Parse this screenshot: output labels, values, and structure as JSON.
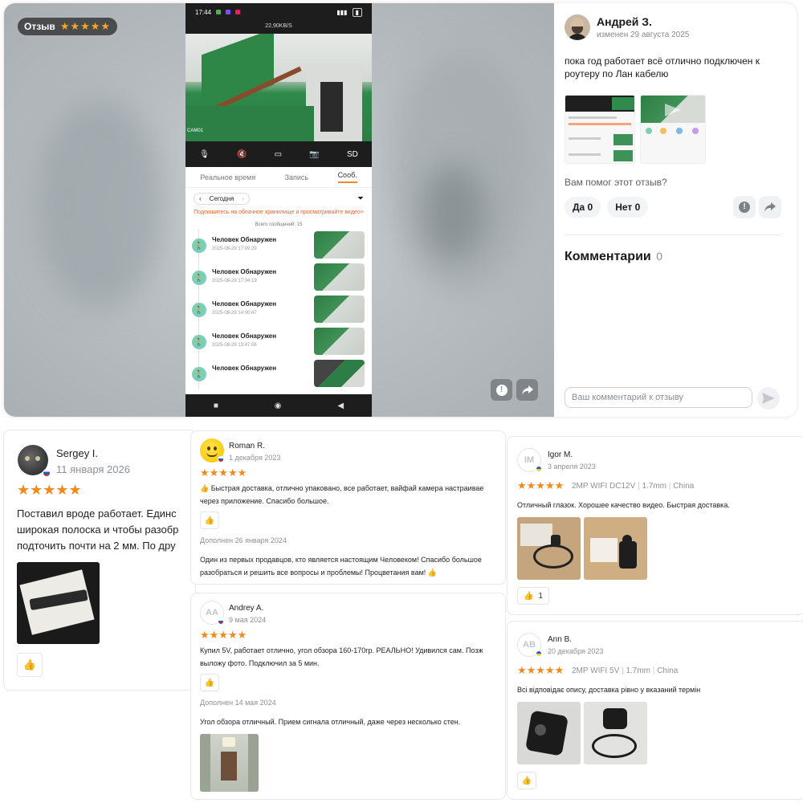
{
  "modal": {
    "badge_label": "Отзыв",
    "badge_stars": "★★★★★",
    "phone": {
      "time": "17:44",
      "speed": "22,90KB/S",
      "cam_label": "CAM01",
      "tools": [
        "mic",
        "mute",
        "record",
        "camera",
        "SD"
      ],
      "tools_sd": "SD",
      "tabs": [
        "Реальное время",
        "Запись",
        "Сооб."
      ],
      "date_label": "Сегодня",
      "cloud_notice": "Подпишитесь на облачное хранилище и просматривайте видео>",
      "total": "Всего сообщений: 15",
      "events": [
        {
          "title": "Человек Обнаружен",
          "date": "2025-08-29 17:09:29"
        },
        {
          "title": "Человек Обнаружен",
          "date": "2025-08-29 17:04:19"
        },
        {
          "title": "Человек Обнаружен",
          "date": "2025-08-29 14:00:47"
        },
        {
          "title": "Человек Обнаружен",
          "date": "2025-08-29 13:47:06"
        },
        {
          "title": "Человек Обнаружен",
          "date": ""
        }
      ]
    },
    "review": {
      "author": "Андрей З.",
      "edited": "изменен 29 августа 2025",
      "text_line1": "пока год работает всё отлично подключен к",
      "text_line2": "роутеру по Лан кабелю",
      "helpful_question": "Вам помог этот отзыв?",
      "yes_label": "Да 0",
      "no_label": "Нет 0",
      "comments_title": "Комментарии",
      "comments_count": "0",
      "comment_placeholder": "Ваш комментарий к отзыву"
    }
  },
  "cards": {
    "sergey": {
      "name": "Sergey I.",
      "date": "11 января 2026",
      "stars": "★★★★★",
      "text": [
        "Поставил вроде работает. Единс",
        "широкая полоска и чтобы разобр",
        "подточить почти на 2 мм. По дру"
      ]
    },
    "roman": {
      "name": "Roman R.",
      "date": "1 декабря 2023",
      "stars": "★★★★★",
      "text": [
        "👍 Быстрая доставка, отлично упаковано, все работает, вайфай камера настраивае",
        "через приложение. Спасибо большое."
      ],
      "addendum_label": "Дополнен 26 января 2024",
      "addendum_text": [
        "Один из первых продавцов, кто является настоящим Человеком! Спасибо большое",
        "разобраться и решить все вопросы и проблемы! Процветания вам! 👍"
      ]
    },
    "andrey": {
      "initials": "AA",
      "name": "Andrey A.",
      "date": "9 мая 2024",
      "stars": "★★★★★",
      "text": [
        "Купил 5V, работает отлично, угол обзора 160-170гр. РЕАЛЬНО! Удивился сам. Позж",
        "выложу фото. Подключил за 5 мин."
      ],
      "addendum_label": "Дополнен 14 мая 2024",
      "addendum_text": "Угол обзора отличный. Прием сигнала отличный, даже через несколько стен."
    },
    "igor": {
      "initials": "IM",
      "name": "Igor M.",
      "date": "3 апреля 2023",
      "stars": "★★★★★",
      "variant": [
        "2MP WIFI DC12V",
        "1.7mm",
        "China"
      ],
      "text": "Отличный глазок. Хорошее качество видео. Быстрая доставка.",
      "likes": "1"
    },
    "ann": {
      "initials": "AB",
      "name": "Ann B.",
      "date": "20 декабря 2023",
      "stars": "★★★★★",
      "variant": [
        "2MP WIFI 5V",
        "1.7mm",
        "China"
      ],
      "text": "Всі відповідає опису, доставка рівно у вказаний термін"
    },
    "separator": "|"
  },
  "colors": {
    "star": "#f08a1c",
    "accent_green": "#2f8a4b",
    "cloud_notice": "#e8612c"
  }
}
